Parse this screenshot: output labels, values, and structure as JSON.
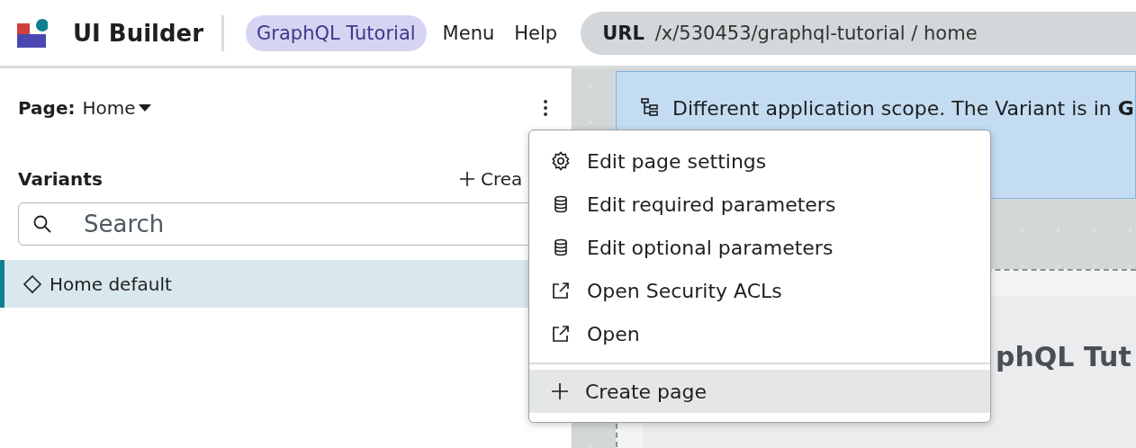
{
  "header": {
    "app_title": "UI Builder",
    "app_pill": "GraphQL Tutorial",
    "nav": [
      "Menu",
      "Help"
    ],
    "url_label": "URL",
    "url_path": "/x/530453/graphql-tutorial / home"
  },
  "sidebar": {
    "page_label": "Page:",
    "page_value": "Home",
    "variants_title": "Variants",
    "create_label": "Crea",
    "search": {
      "placeholder": "Search"
    },
    "variants": [
      {
        "label": "Home default",
        "selected": true
      }
    ]
  },
  "canvas": {
    "banner": "Different application scope. The Variant is in **G**",
    "heading": "phQL Tut"
  },
  "menu": {
    "items": [
      {
        "label": "Edit page settings",
        "kind": "settings",
        "selected": false,
        "divider_before": false
      },
      {
        "label": "Edit required parameters",
        "kind": "database",
        "selected": false,
        "divider_before": false
      },
      {
        "label": "Edit optional parameters",
        "kind": "database",
        "selected": false,
        "divider_before": false
      },
      {
        "label": "Open Security ACLs",
        "kind": "external",
        "selected": false,
        "divider_before": false
      },
      {
        "label": "Open",
        "kind": "external",
        "selected": false,
        "divider_before": false
      },
      {
        "label": "Create page",
        "kind": "add",
        "selected": true,
        "divider_before": true
      }
    ]
  }
}
